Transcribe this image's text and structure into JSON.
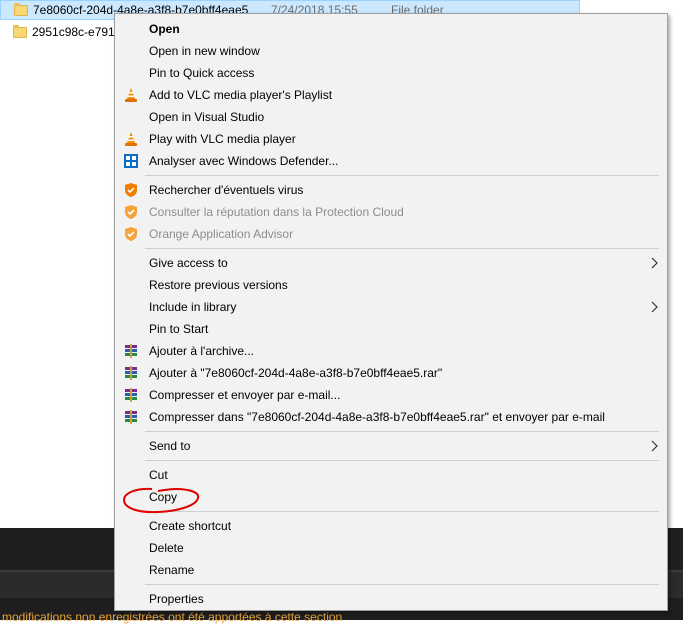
{
  "files": [
    {
      "name": "7e8060cf-204d-4a8e-a3f8-b7e0bff4eae5",
      "date": "7/24/2018 15:55",
      "type": "File folder",
      "selected": true
    },
    {
      "name": "2951c98c-e791-",
      "date": "",
      "type": "",
      "selected": false
    }
  ],
  "status": {
    "text": "modifications non enregistrées ont été apportées à cette section"
  },
  "menu": {
    "open": "Open",
    "open_new_window": "Open in new window",
    "pin_quick_access": "Pin to Quick access",
    "vlc_playlist": "Add to VLC media player's Playlist",
    "open_vs": "Open in Visual Studio",
    "vlc_play": "Play with VLC media player",
    "defender": "Analyser avec Windows Defender...",
    "rechercher_virus": "Rechercher d'éventuels virus",
    "consulter_reputation": "Consulter la réputation dans la Protection Cloud",
    "orange_advisor": "Orange Application Advisor",
    "give_access": "Give access to",
    "restore_versions": "Restore previous versions",
    "include_library": "Include in library",
    "pin_start": "Pin to Start",
    "ajouter_archive": "Ajouter à l'archive...",
    "ajouter_rar": "Ajouter à \"7e8060cf-204d-4a8e-a3f8-b7e0bff4eae5.rar\"",
    "compresser_email": "Compresser et envoyer par e-mail...",
    "compresser_rar_email": "Compresser dans \"7e8060cf-204d-4a8e-a3f8-b7e0bff4eae5.rar\" et envoyer par e-mail",
    "send_to": "Send to",
    "cut": "Cut",
    "copy": "Copy",
    "create_shortcut": "Create shortcut",
    "delete": "Delete",
    "rename": "Rename",
    "properties": "Properties"
  },
  "icons": {
    "vlc": "vlc-cone-icon",
    "defender": "windows-defender-icon",
    "shield": "antivirus-shield-icon",
    "winrar": "winrar-books-icon",
    "submenu": "chevron-right-icon"
  },
  "colors": {
    "menu_bg": "#f2f2f2",
    "selection": "#cce8ff",
    "disabled_text": "#8d8d8d",
    "annotation": "#e00000",
    "status_text": "#e8a33d"
  }
}
